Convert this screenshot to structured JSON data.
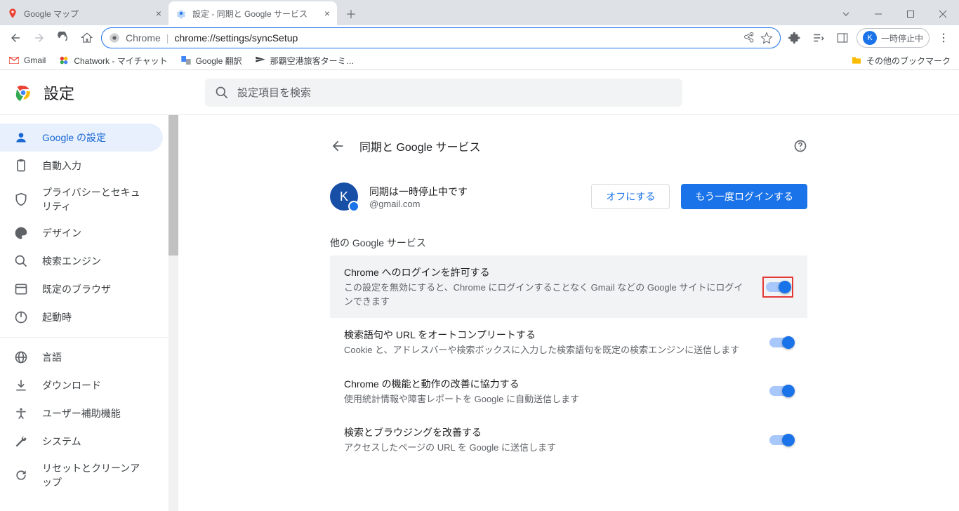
{
  "tabs": [
    {
      "title": "Google マップ",
      "active": false
    },
    {
      "title": "設定 - 同期と Google サービス",
      "active": true
    }
  ],
  "omnibox": {
    "scheme_label": "Chrome",
    "url": "chrome://settings/syncSetup"
  },
  "profile_pill": {
    "initial": "K",
    "status": "一時停止中"
  },
  "bookmarks": [
    {
      "label": "Gmail"
    },
    {
      "label": "Chatwork - マイチャット"
    },
    {
      "label": "Google 翻訳"
    },
    {
      "label": "那覇空港旅客ターミ…"
    }
  ],
  "bookmarks_other": "その他のブックマーク",
  "settings": {
    "title": "設定",
    "search_placeholder": "設定項目を検索",
    "nav": [
      {
        "label": "Google の設定",
        "active": true
      },
      {
        "label": "自動入力"
      },
      {
        "label": "プライバシーとセキュリティ"
      },
      {
        "label": "デザイン"
      },
      {
        "label": "検索エンジン"
      },
      {
        "label": "既定のブラウザ"
      },
      {
        "label": "起動時"
      }
    ],
    "nav2": [
      {
        "label": "言語"
      },
      {
        "label": "ダウンロード"
      },
      {
        "label": "ユーザー補助機能"
      },
      {
        "label": "システム"
      },
      {
        "label": "リセットとクリーンアップ"
      }
    ],
    "page_title": "同期と Google サービス",
    "sync": {
      "avatar_initial": "K",
      "status": "同期は一時停止中です",
      "email": "@gmail.com",
      "btn_off": "オフにする",
      "btn_login": "もう一度ログインする"
    },
    "other_services_label": "他の Google サービス",
    "rows": [
      {
        "title": "Chrome へのログインを許可する",
        "desc": "この設定を無効にすると、Chrome にログインすることなく Gmail などの Google サイトにログインできます",
        "highlighted": true,
        "toggle_highlight": true
      },
      {
        "title": "検索語句や URL をオートコンプリートする",
        "desc": "Cookie と、アドレスバーや検索ボックスに入力した検索語句を既定の検索エンジンに送信します"
      },
      {
        "title": "Chrome の機能と動作の改善に協力する",
        "desc": "使用統計情報や障害レポートを Google に自動送信します"
      },
      {
        "title": "検索とブラウジングを改善する",
        "desc": "アクセスしたページの URL を Google に送信します"
      }
    ]
  }
}
